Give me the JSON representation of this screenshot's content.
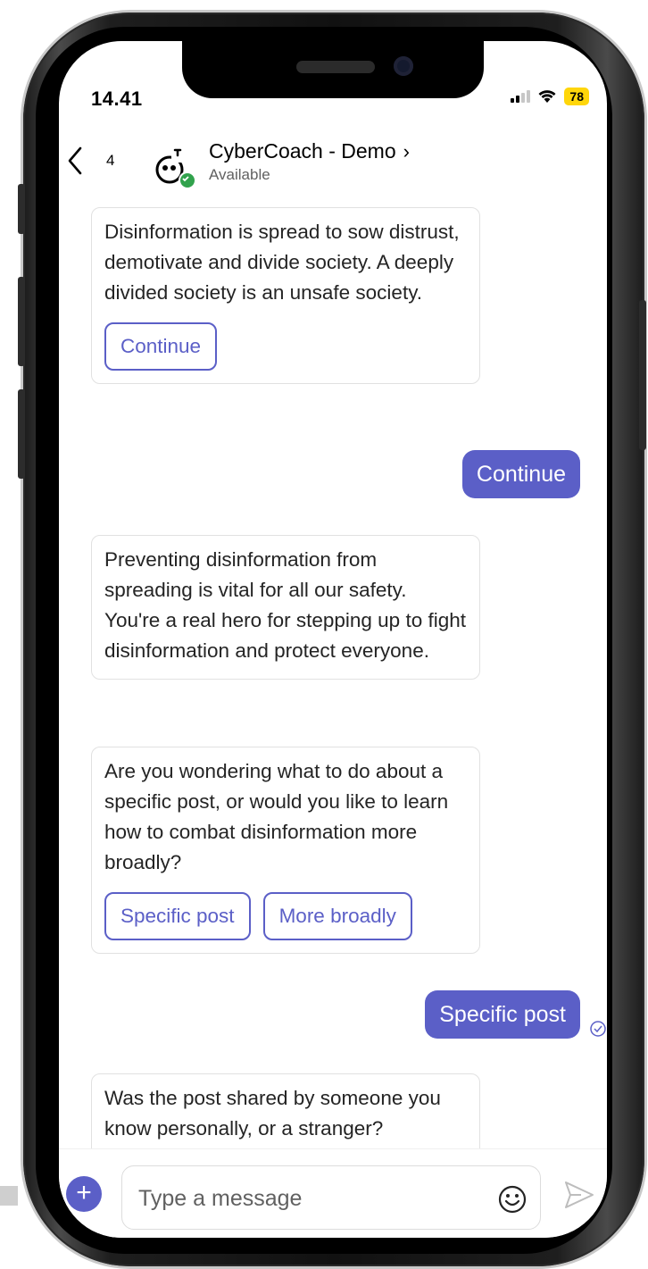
{
  "status_bar": {
    "time": "14.41",
    "battery": "78",
    "battery_color": "#ffd60a"
  },
  "header": {
    "unread_count": "4",
    "title": "CyberCoach - Demo",
    "title_chevron": "›",
    "presence": "Available",
    "icons": {
      "back": "chevron-left-icon",
      "avatar": "bot-avatar-icon"
    }
  },
  "messages": [
    {
      "from": "bot",
      "text": "Disinformation is spread to sow distrust, demotivate and divide society. A deeply divided society is an unsafe society.",
      "actions": [
        "Continue"
      ]
    },
    {
      "from": "user",
      "text": "Continue"
    },
    {
      "from": "bot",
      "text": "Preventing disinformation from spreading is vital for all our safety. You're a real hero for stepping up to fight disinformation and protect everyone.",
      "actions": []
    },
    {
      "from": "bot",
      "text": "Are you wondering what to do about a specific post, or would you like to learn how to combat disinformation more broadly?",
      "actions": [
        "Specific post",
        "More broadly"
      ]
    },
    {
      "from": "user",
      "text": "Specific post"
    },
    {
      "from": "bot",
      "text": "Was the post shared by someone you know personally, or a stranger?",
      "actions": []
    }
  ],
  "compose": {
    "placeholder": "Type a message",
    "add_label": "+"
  },
  "colors": {
    "accent": "#5b5fc7",
    "presence": "#31a24c"
  }
}
